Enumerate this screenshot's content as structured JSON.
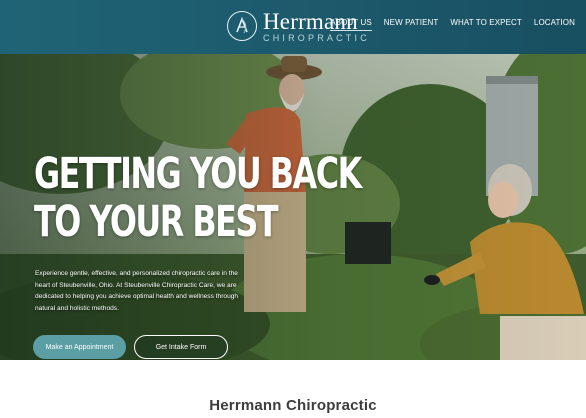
{
  "header": {
    "logo": {
      "title": "Herrmann",
      "subtitle": "CHIROPRACTIC"
    },
    "nav": [
      {
        "label": "ABOUT US",
        "active": true
      },
      {
        "label": "NEW PATIENT",
        "active": false
      },
      {
        "label": "WHAT TO EXPECT",
        "active": false
      },
      {
        "label": "LOCATION",
        "active": false
      }
    ]
  },
  "hero": {
    "headline_line1": "GETTING YOU BACK",
    "headline_line2": "TO YOUR BEST",
    "description": "Experience gentle, effective, and personalized chiropractic care in the heart of Steubenville, Ohio. At Steubenville Chiropractic Care, we are dedicated to helping you achieve optimal health and wellness through natural and holistic methods.",
    "primary_button": "Make an Appointment",
    "secondary_button": "Get Intake Form"
  },
  "section": {
    "title": "Herrmann Chiropractic"
  },
  "colors": {
    "header": "#1f6476",
    "primary_button": "#5b9ea3",
    "body_text": "#3d3d3d"
  }
}
